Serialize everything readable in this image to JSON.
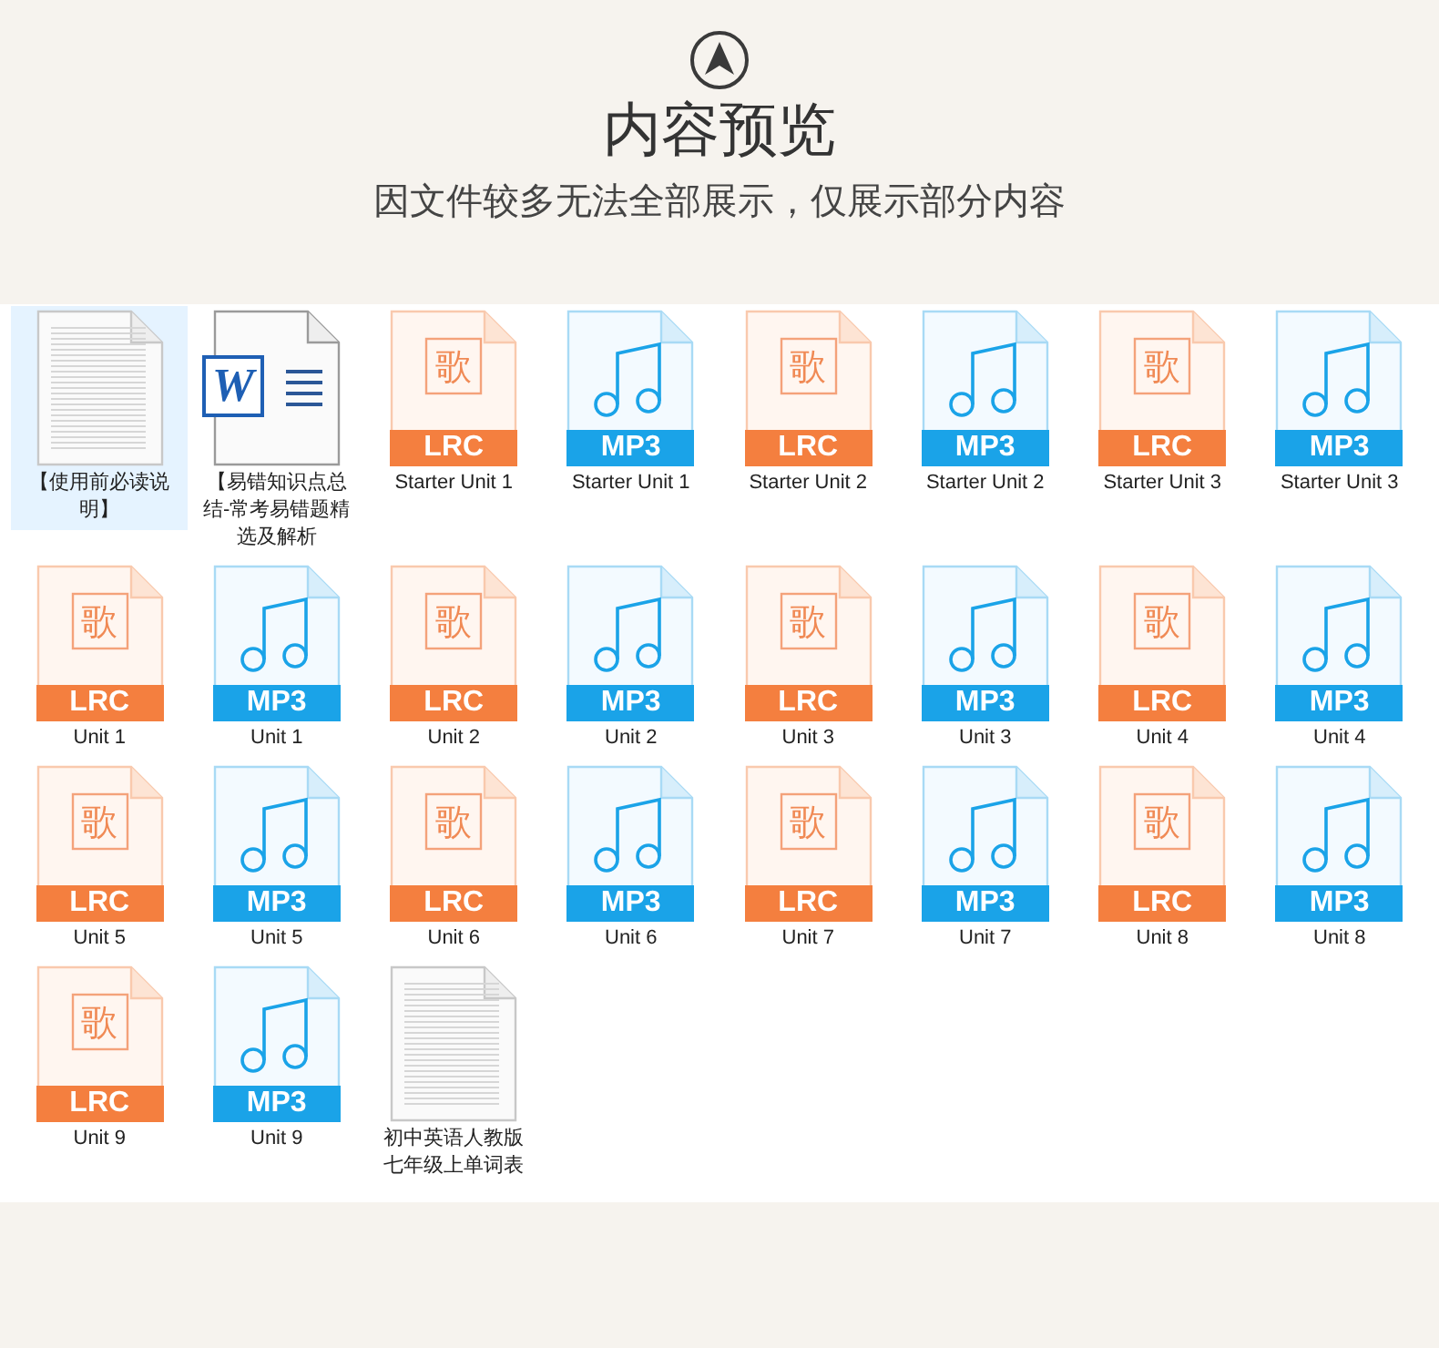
{
  "header": {
    "title": "内容预览",
    "subtitle": "因文件较多无法全部展示，仅展示部分内容"
  },
  "files": [
    {
      "kind": "txt",
      "label": "【使用前必读说明】",
      "selected": true
    },
    {
      "kind": "doc",
      "label": "【易错知识点总结-常考易错题精选及解析",
      "logo": "W",
      "selected": false
    },
    {
      "kind": "lrc",
      "label": "Starter Unit 1",
      "badge": "LRC",
      "glyph": "歌",
      "selected": false
    },
    {
      "kind": "mp3",
      "label": "Starter Unit 1",
      "badge": "MP3",
      "selected": false
    },
    {
      "kind": "lrc",
      "label": "Starter Unit 2",
      "badge": "LRC",
      "glyph": "歌",
      "selected": false
    },
    {
      "kind": "mp3",
      "label": "Starter Unit 2",
      "badge": "MP3",
      "selected": false
    },
    {
      "kind": "lrc",
      "label": "Starter Unit 3",
      "badge": "LRC",
      "glyph": "歌",
      "selected": false
    },
    {
      "kind": "mp3",
      "label": "Starter Unit 3",
      "badge": "MP3",
      "selected": false
    },
    {
      "kind": "lrc",
      "label": "Unit 1",
      "badge": "LRC",
      "glyph": "歌",
      "selected": false
    },
    {
      "kind": "mp3",
      "label": "Unit 1",
      "badge": "MP3",
      "selected": false
    },
    {
      "kind": "lrc",
      "label": "Unit 2",
      "badge": "LRC",
      "glyph": "歌",
      "selected": false
    },
    {
      "kind": "mp3",
      "label": "Unit 2",
      "badge": "MP3",
      "selected": false
    },
    {
      "kind": "lrc",
      "label": "Unit 3",
      "badge": "LRC",
      "glyph": "歌",
      "selected": false
    },
    {
      "kind": "mp3",
      "label": "Unit 3",
      "badge": "MP3",
      "selected": false
    },
    {
      "kind": "lrc",
      "label": "Unit 4",
      "badge": "LRC",
      "glyph": "歌",
      "selected": false
    },
    {
      "kind": "mp3",
      "label": "Unit 4",
      "badge": "MP3",
      "selected": false
    },
    {
      "kind": "lrc",
      "label": "Unit 5",
      "badge": "LRC",
      "glyph": "歌",
      "selected": false
    },
    {
      "kind": "mp3",
      "label": "Unit 5",
      "badge": "MP3",
      "selected": false
    },
    {
      "kind": "lrc",
      "label": "Unit 6",
      "badge": "LRC",
      "glyph": "歌",
      "selected": false
    },
    {
      "kind": "mp3",
      "label": "Unit 6",
      "badge": "MP3",
      "selected": false
    },
    {
      "kind": "lrc",
      "label": "Unit 7",
      "badge": "LRC",
      "glyph": "歌",
      "selected": false
    },
    {
      "kind": "mp3",
      "label": "Unit 7",
      "badge": "MP3",
      "selected": false
    },
    {
      "kind": "lrc",
      "label": "Unit 8",
      "badge": "LRC",
      "glyph": "歌",
      "selected": false
    },
    {
      "kind": "mp3",
      "label": "Unit 8",
      "badge": "MP3",
      "selected": false
    },
    {
      "kind": "lrc",
      "label": "Unit 9",
      "badge": "LRC",
      "glyph": "歌",
      "selected": false
    },
    {
      "kind": "mp3",
      "label": "Unit 9",
      "badge": "MP3",
      "selected": false
    },
    {
      "kind": "txt",
      "label": "初中英语人教版七年级上单词表",
      "selected": false
    }
  ]
}
